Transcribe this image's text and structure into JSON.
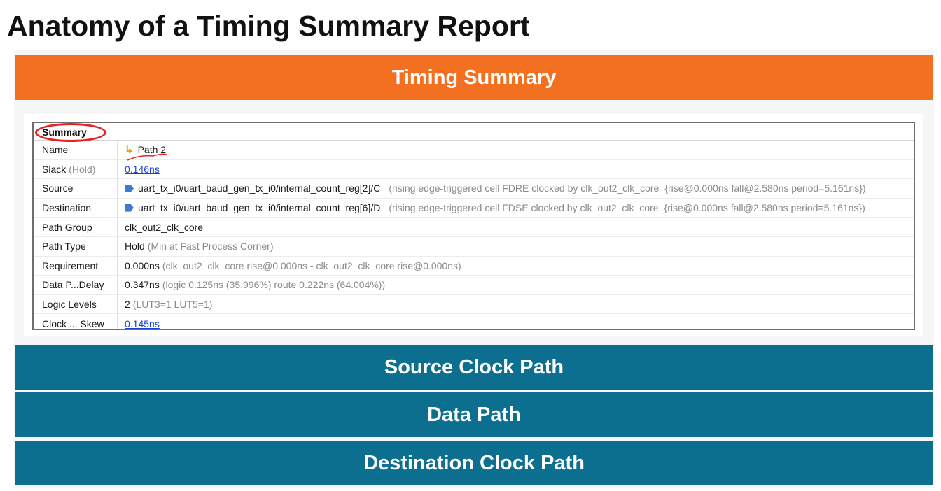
{
  "page_title": "Anatomy of a Timing Summary Report",
  "bands": {
    "timing_summary": "Timing Summary",
    "source_clock_path": "Source Clock Path",
    "data_path": "Data Path",
    "destination_clock_path": "Destination Clock Path"
  },
  "colors": {
    "orange": "#f37021",
    "teal": "#0d6f8f",
    "annotation_red": "#e52222",
    "link_blue": "#1a3fd6"
  },
  "summary": {
    "header": "Summary",
    "rows": {
      "name": {
        "label": "Name",
        "value": "Path 2"
      },
      "slack": {
        "label": "Slack",
        "label_suffix": "(Hold)",
        "value": "0.146ns"
      },
      "source": {
        "label": "Source",
        "value": "uart_tx_i0/uart_baud_gen_tx_i0/internal_count_reg[2]/C",
        "detail": "(rising edge-triggered cell FDRE clocked by clk_out2_clk_core",
        "detail2": "{rise@0.000ns fall@2.580ns period=5.161ns})"
      },
      "destination": {
        "label": "Destination",
        "value": "uart_tx_i0/uart_baud_gen_tx_i0/internal_count_reg[6]/D",
        "detail": "(rising edge-triggered cell FDSE clocked by clk_out2_clk_core",
        "detail2": "{rise@0.000ns fall@2.580ns period=5.161ns})"
      },
      "path_group": {
        "label": "Path Group",
        "value": "clk_out2_clk_core"
      },
      "path_type": {
        "label": "Path Type",
        "value": "Hold",
        "detail": "(Min at Fast Process Corner)"
      },
      "requirement": {
        "label": "Requirement",
        "value": "0.000ns",
        "detail": "(clk_out2_clk_core rise@0.000ns - clk_out2_clk_core rise@0.000ns)"
      },
      "data_path_delay": {
        "label": "Data P...Delay",
        "value": "0.347ns",
        "detail": "(logic 0.125ns (35.996%)  route 0.222ns (64.004%))"
      },
      "logic_levels": {
        "label": "Logic Levels",
        "value": "2",
        "detail": "(LUT3=1 LUT5=1)"
      },
      "clock_skew": {
        "label": "Clock ... Skew",
        "value": "0.145ns"
      }
    }
  },
  "icons": {
    "path_icon": "path-arrow-icon",
    "pin_icon": "pin-icon"
  }
}
